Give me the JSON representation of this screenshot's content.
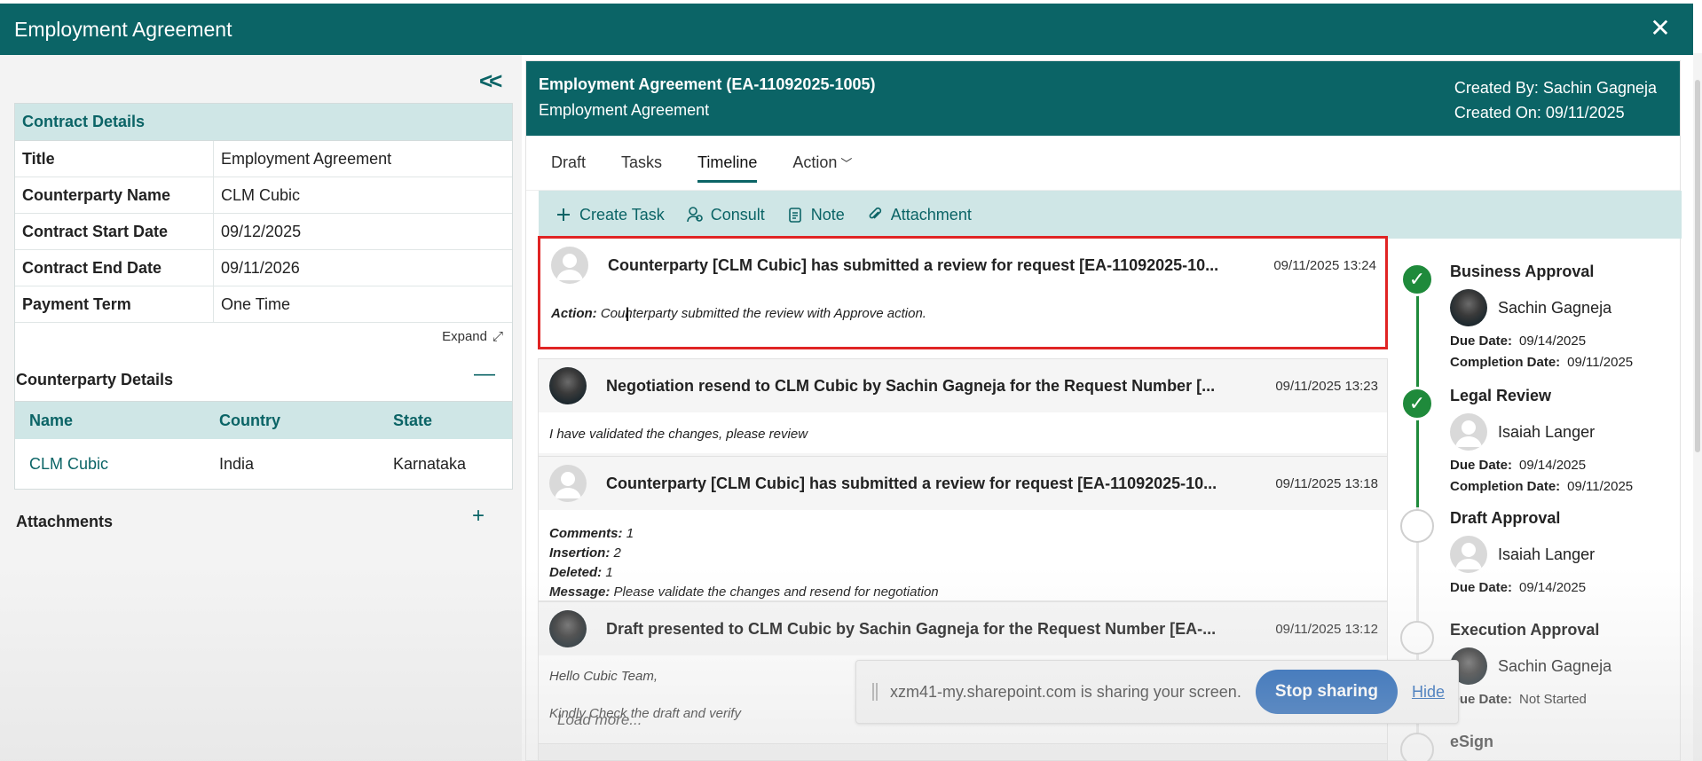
{
  "window": {
    "title": "Employment Agreement"
  },
  "left": {
    "contract_details": {
      "heading": "Contract Details",
      "rows": [
        {
          "label": "Title",
          "value": "Employment Agreement"
        },
        {
          "label": "Counterparty Name",
          "value": "CLM Cubic"
        },
        {
          "label": "Contract Start Date",
          "value": "09/12/2025"
        },
        {
          "label": "Contract End Date",
          "value": "09/11/2026"
        },
        {
          "label": "Payment Term",
          "value": "One Time"
        }
      ],
      "expand_label": "Expand"
    },
    "counterparty_details": {
      "heading": "Counterparty Details",
      "columns": [
        "Name",
        "Country",
        "State"
      ],
      "row": {
        "name": "CLM Cubic",
        "country": "India",
        "state": "Karnataka"
      }
    },
    "attachments": {
      "heading": "Attachments"
    }
  },
  "main": {
    "header": {
      "title": "Employment Agreement (EA-11092025-1005)",
      "subtitle": "Employment Agreement",
      "created_by": "Created By: Sachin Gagneja",
      "created_on": "Created On: 09/11/2025"
    },
    "tabs": [
      {
        "label": "Draft"
      },
      {
        "label": "Tasks"
      },
      {
        "label": "Timeline",
        "active": true
      },
      {
        "label": "Action"
      }
    ],
    "toolbar": {
      "create_task": "Create Task",
      "consult": "Consult",
      "note": "Note",
      "attachment": "Attachment"
    },
    "timeline": [
      {
        "title": "Counterparty [CLM Cubic] has submitted a review for request [EA-11092025-10...",
        "time": "09/11/2025 13:24",
        "avatar": "blank",
        "highlighted": true,
        "action_label": "Action:",
        "action_text": "Counterparty submitted the review with Approve action."
      },
      {
        "title": "Negotiation resend to CLM Cubic by Sachin Gagneja for the Request Number [...",
        "time": "09/11/2025 13:23",
        "avatar": "photo",
        "body": "I have validated the changes, please review"
      },
      {
        "title": "Counterparty [CLM Cubic] has submitted a review for request [EA-11092025-10...",
        "time": "09/11/2025 13:18",
        "avatar": "blank",
        "comments_label": "Comments:",
        "comments": "1",
        "insertion_label": "Insertion:",
        "insertion": "2",
        "deleted_label": "Deleted:",
        "deleted": "1",
        "message_label": "Message:",
        "message": "Please validate the changes and resend for negotiation"
      },
      {
        "title": "Draft presented to CLM Cubic by Sachin Gagneja for the Request Number [EA-...",
        "time": "09/11/2025 13:12",
        "avatar": "photo",
        "line1": "Hello Cubic Team,",
        "line2": "Kindly Check the draft and verify"
      }
    ],
    "load_more": "Load more...",
    "approvals": [
      {
        "title": "Business Approval",
        "person": "Sachin Gagneja",
        "due_label": "Due Date:",
        "due": "09/14/2025",
        "completion_label": "Completion Date:",
        "completion": "09/11/2025",
        "status": "done"
      },
      {
        "title": "Legal Review",
        "person": "Isaiah Langer",
        "due_label": "Due Date:",
        "due": "09/14/2025",
        "completion_label": "Completion Date:",
        "completion": "09/11/2025",
        "status": "done"
      },
      {
        "title": "Draft Approval",
        "person": "Isaiah Langer",
        "due_label": "Due Date:",
        "due": "09/14/2025",
        "status": "pending"
      },
      {
        "title": "Execution Approval",
        "person": "Sachin Gagneja",
        "due_label": "Due Date:",
        "due": "Not Started",
        "status": "pending"
      },
      {
        "title": "eSign",
        "status": "pending"
      }
    ]
  },
  "share_bar": {
    "message": "xzm41-my.sharepoint.com is sharing your screen.",
    "stop_label": "Stop sharing",
    "hide_label": "Hide"
  },
  "colors": {
    "brand": "#0b6466",
    "accent_light": "#cfe6e6",
    "success": "#1f8a3b",
    "highlight": "#e02424",
    "link": "#1a5fb4"
  }
}
